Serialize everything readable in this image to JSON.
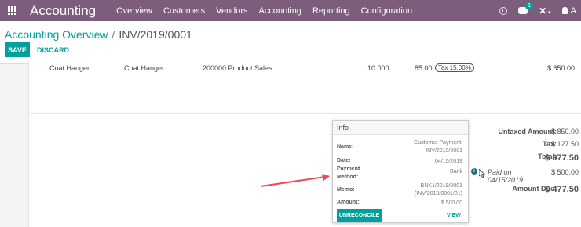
{
  "navbar": {
    "app_title": "Accounting",
    "menu": [
      "Overview",
      "Customers",
      "Vendors",
      "Accounting",
      "Reporting",
      "Configuration"
    ],
    "chat_badge": "1",
    "user_initial": "A"
  },
  "breadcrumb": {
    "parent": "Accounting Overview",
    "separator": "/",
    "current": "INV/2019/0001"
  },
  "buttons": {
    "save": "SAVE",
    "discard": "DISCARD"
  },
  "invoice_line": {
    "product": "Coat Hanger",
    "description": "Coat Hanger",
    "account": "200000 Product Sales",
    "quantity": "10.000",
    "unit_price": "85.00",
    "tax": "Tax 15.00%",
    "subtotal": "$ 850.00"
  },
  "totals": {
    "untaxed_label": "Untaxed Amount:",
    "untaxed_value": "$ 850.00",
    "tax_label": "Tax:",
    "tax_value": "$ 127.50",
    "total_label": "Total:",
    "total_value": "$ 977.50",
    "paid_text": "Paid on 04/15/2019",
    "paid_value": "$ 500.00",
    "amount_due_label": "Amount Due:",
    "amount_due_value": "$ 477.50"
  },
  "popover": {
    "title": "Info",
    "name_label": "Name:",
    "name_value_1": "Customer Payment:",
    "name_value_2": "INV/2019/0001",
    "date_label": "Date:",
    "date_value": "04/15/2019",
    "method_label_1": "Payment",
    "method_label_2": "Method:",
    "method_value": "Bank",
    "memo_label": "Memo:",
    "memo_value_1": "BNK1/2019/0001",
    "memo_value_2": "(INV/2019/0001/01)",
    "amount_label": "Amount:",
    "amount_value": "$ 500.00",
    "unreconcile": "UNRECONCILE",
    "view": "VIEW"
  },
  "colors": {
    "navbar": "#7c5e7c",
    "accent": "#00a09d",
    "annotation_arrow": "#e8485a"
  }
}
